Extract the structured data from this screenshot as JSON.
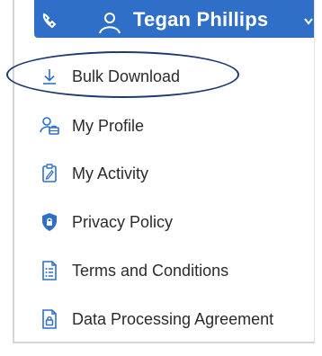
{
  "header": {
    "user_name": "Tegan Phillips",
    "background_color": "#2f6fc8"
  },
  "menu": {
    "items": [
      {
        "label": "Bulk Download",
        "icon": "download-icon"
      },
      {
        "label": "My Profile",
        "icon": "profile-icon"
      },
      {
        "label": "My Activity",
        "icon": "activity-clipboard-icon"
      },
      {
        "label": "Privacy Policy",
        "icon": "shield-lock-icon"
      },
      {
        "label": "Terms and Conditions",
        "icon": "document-list-icon"
      },
      {
        "label": "Data Processing Agreement",
        "icon": "document-lock-icon"
      }
    ]
  },
  "colors": {
    "icon_blue": "#2f6fc8",
    "text": "#2b2b2b",
    "highlight_outline": "#1f3a73"
  }
}
